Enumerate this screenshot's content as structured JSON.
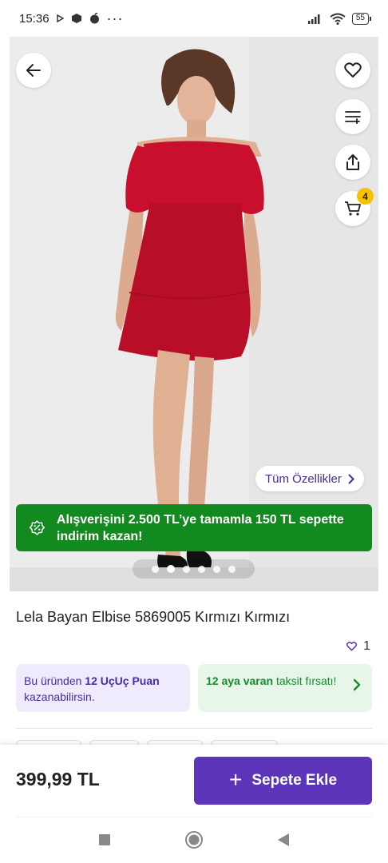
{
  "status_bar": {
    "time": "15:36",
    "dots": "···",
    "battery": "55"
  },
  "hero": {
    "back_icon": "arrow-left-icon",
    "actions": [
      "heart-icon",
      "filter-icon",
      "share-icon",
      "cart-icon"
    ],
    "cart_count": "4",
    "features_label": "Tüm Özellikler",
    "promo_text": "Alışverişini 2.500 TL’ye tamamla 150 TL sepette indirim kazan!",
    "image_dots": 6,
    "active_dot": 1,
    "dress_color": "#c8102e"
  },
  "product": {
    "title": "Lela Bayan Elbise 5869005 Kırmızı Kırmızı",
    "like_count": "1"
  },
  "cards": {
    "points_prefix": "Bu üründen ",
    "points_bold": "12 UçUç Puan",
    "points_suffix": " kazanabilirsin.",
    "installment_bold": "12 aya varan",
    "installment_suffix": " taksit fırsatı!"
  },
  "bottom": {
    "price": "399,99 TL",
    "add_to_cart": "Sepete Ekle"
  },
  "colors": {
    "accent": "#5c35b8",
    "promo_green": "#128a1f",
    "badge_yellow": "#f6c200"
  }
}
